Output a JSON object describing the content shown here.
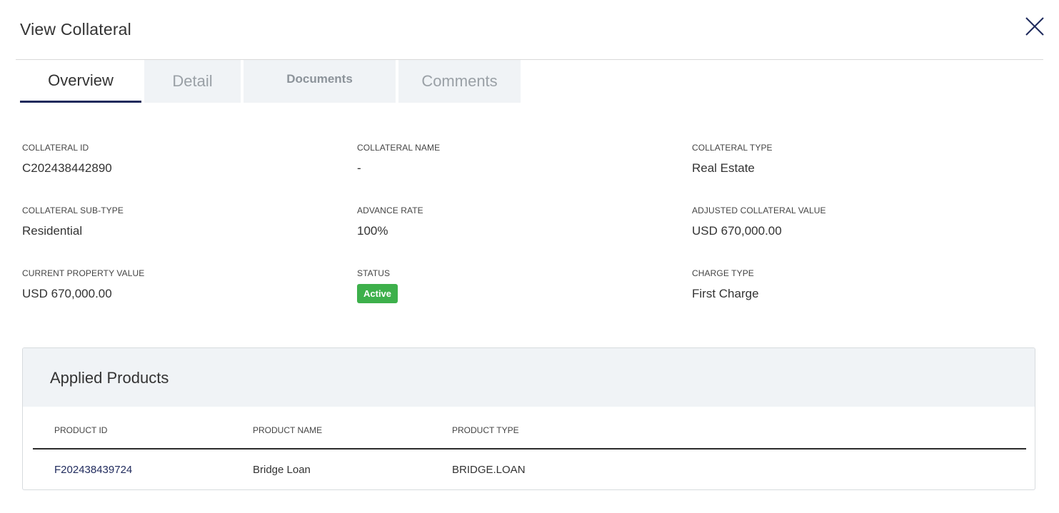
{
  "dialog": {
    "title": "View Collateral",
    "close_icon": "close-icon"
  },
  "tabs": [
    {
      "label": "Overview",
      "active": true
    },
    {
      "label": "Detail",
      "active": false
    },
    {
      "label": "Documents",
      "active": false
    },
    {
      "label": "Comments",
      "active": false
    }
  ],
  "fields": {
    "collateral_id": {
      "label": "COLLATERAL ID",
      "value": "C202438442890"
    },
    "collateral_name": {
      "label": "COLLATERAL NAME",
      "value": "-"
    },
    "collateral_type": {
      "label": "COLLATERAL TYPE",
      "value": "Real Estate"
    },
    "collateral_sub_type": {
      "label": "COLLATERAL SUB-TYPE",
      "value": "Residential"
    },
    "advance_rate": {
      "label": "ADVANCE RATE",
      "value": "100%"
    },
    "adjusted_collateral_value": {
      "label": "ADJUSTED COLLATERAL VALUE",
      "value": "USD 670,000.00"
    },
    "current_property_value": {
      "label": "CURRENT PROPERTY VALUE",
      "value": "USD 670,000.00"
    },
    "status": {
      "label": "STATUS",
      "value": "Active",
      "color": "#3db04b"
    },
    "charge_type": {
      "label": "CHARGE TYPE",
      "value": "First Charge"
    }
  },
  "applied_products": {
    "title": "Applied Products",
    "columns": [
      "PRODUCT ID",
      "PRODUCT NAME",
      "PRODUCT TYPE"
    ],
    "rows": [
      {
        "product_id": "F202438439724",
        "product_name": "Bridge Loan",
        "product_type": "BRIDGE.LOAN"
      }
    ]
  },
  "colors": {
    "accent": "#1f2a5c",
    "tab_bg": "#f0f3f6",
    "success": "#3db04b"
  }
}
